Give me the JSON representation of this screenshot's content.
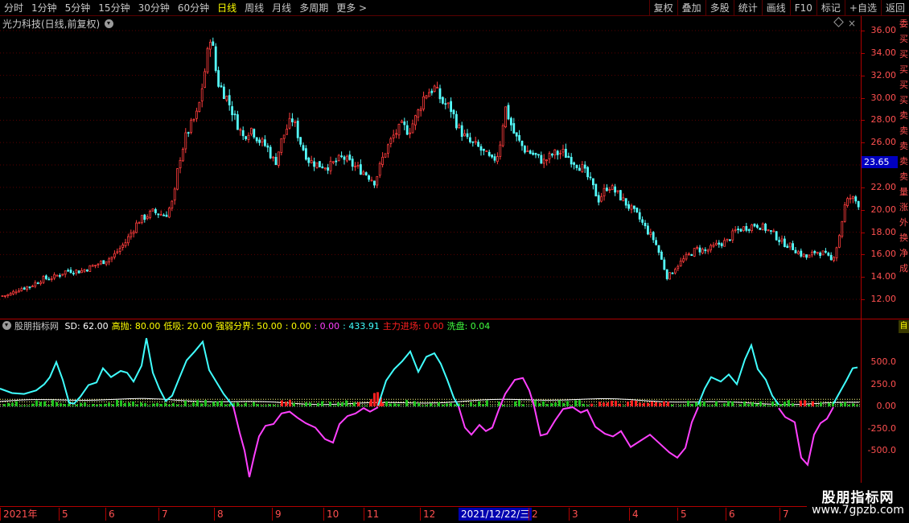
{
  "toolbar": {
    "periods": [
      "分时",
      "1分钟",
      "5分钟",
      "15分钟",
      "30分钟",
      "60分钟",
      "日线",
      "周线",
      "月线",
      "多周期",
      "更多 >"
    ],
    "active_period": "日线",
    "buttons": [
      "复权",
      "叠加",
      "多股",
      "统计",
      "画线",
      "F10",
      "标记",
      "+自选",
      "返回"
    ]
  },
  "stock": {
    "title": "光力科技(日线,前复权)",
    "current_price": "23.65"
  },
  "price_axis": {
    "ticks": [
      "36.00",
      "34.00",
      "32.00",
      "30.00",
      "28.00",
      "26.00",
      "24.00",
      "22.00",
      "20.00",
      "18.00",
      "16.00",
      "14.00",
      "12.00"
    ]
  },
  "side_strip": {
    "chars": [
      "委",
      "买",
      "买",
      "买",
      "买",
      "买",
      "卖",
      "卖",
      "卖",
      "卖",
      "卖",
      "量",
      "涨",
      "外",
      "换",
      "净",
      "成"
    ],
    "tag": "自"
  },
  "indicator": {
    "name": "股朋指标网",
    "legend": [
      {
        "text": "SD: 62.00",
        "color": "#ffffff"
      },
      {
        "text": "高抛: 80.00",
        "color": "#ffff00"
      },
      {
        "text": "低吸: 20.00",
        "color": "#ffff00"
      },
      {
        "text": "强弱分界: 50.00",
        "color": "#ffff00"
      },
      {
        "text": ": 0.00",
        "color": "#ffff00"
      },
      {
        "text": ": 0.00",
        "color": "#ff40ff"
      },
      {
        "text": ": 433.91",
        "color": "#40ffff"
      },
      {
        "text": "主力进场: 0.00",
        "color": "#ff2020"
      },
      {
        "text": "洗盘: 0.04",
        "color": "#40ff40"
      }
    ],
    "axis_ticks": [
      "500.0",
      "250.0",
      "0.00",
      "-250.0",
      "-500.0"
    ]
  },
  "date_axis": {
    "labels": [
      "2021年",
      "5",
      "6",
      "7",
      "8",
      "9",
      "10",
      "11",
      "12",
      "2",
      "3",
      "4",
      "5",
      "6",
      "7"
    ],
    "cursor_date": "2021/12/22/三"
  },
  "watermark": {
    "title": "股朋指标网",
    "url": "www.7gpzb.com"
  },
  "chart_data": [
    {
      "type": "candlestick",
      "title": "光力科技(日线,前复权)",
      "y_range": [
        11,
        37
      ],
      "y_ticks": [
        12,
        14,
        16,
        18,
        20,
        22,
        24,
        26,
        28,
        30,
        32,
        34,
        36
      ],
      "current_price": 23.65,
      "grid": true,
      "close_path": [
        [
          0,
          12.3
        ],
        [
          12,
          12.4
        ],
        [
          22,
          12.9
        ],
        [
          38,
          13.2
        ],
        [
          52,
          13.8
        ],
        [
          68,
          14.0
        ],
        [
          84,
          14.6
        ],
        [
          100,
          14.5
        ],
        [
          120,
          15.1
        ],
        [
          140,
          15.8
        ],
        [
          156,
          17.1
        ],
        [
          172,
          19.0
        ],
        [
          190,
          19.8
        ],
        [
          206,
          19.5
        ],
        [
          216,
          20.9
        ],
        [
          222,
          24.2
        ],
        [
          232,
          26.8
        ],
        [
          246,
          28.7
        ],
        [
          256,
          33.0
        ],
        [
          262,
          35.8
        ],
        [
          270,
          31.5
        ],
        [
          282,
          30.0
        ],
        [
          292,
          28.2
        ],
        [
          302,
          26.5
        ],
        [
          312,
          27.3
        ],
        [
          322,
          26.2
        ],
        [
          332,
          25.6
        ],
        [
          342,
          24.1
        ],
        [
          350,
          26.2
        ],
        [
          358,
          27.5
        ],
        [
          364,
          28.1
        ],
        [
          374,
          25.9
        ],
        [
          384,
          24.4
        ],
        [
          396,
          24.0
        ],
        [
          410,
          23.9
        ],
        [
          426,
          24.7
        ],
        [
          440,
          23.9
        ],
        [
          454,
          23.3
        ],
        [
          466,
          22.5
        ],
        [
          478,
          25.1
        ],
        [
          490,
          26.7
        ],
        [
          500,
          27.5
        ],
        [
          508,
          27.0
        ],
        [
          518,
          28.4
        ],
        [
          528,
          30.3
        ],
        [
          540,
          30.9
        ],
        [
          550,
          29.6
        ],
        [
          560,
          29.1
        ],
        [
          570,
          27.3
        ],
        [
          582,
          26.1
        ],
        [
          594,
          25.6
        ],
        [
          604,
          24.9
        ],
        [
          612,
          24.3
        ],
        [
          620,
          25.1
        ],
        [
          628,
          29.2
        ],
        [
          640,
          26.6
        ],
        [
          652,
          25.4
        ],
        [
          664,
          24.9
        ],
        [
          676,
          24.3
        ],
        [
          688,
          25.0
        ],
        [
          700,
          25.1
        ],
        [
          712,
          24.4
        ],
        [
          724,
          23.7
        ],
        [
          734,
          22.5
        ],
        [
          744,
          20.9
        ],
        [
          756,
          22.2
        ],
        [
          768,
          21.4
        ],
        [
          780,
          20.4
        ],
        [
          792,
          19.5
        ],
        [
          804,
          18.2
        ],
        [
          814,
          17.2
        ],
        [
          822,
          15.6
        ],
        [
          830,
          13.9
        ],
        [
          840,
          14.9
        ],
        [
          852,
          15.7
        ],
        [
          866,
          16.5
        ],
        [
          878,
          16.3
        ],
        [
          892,
          16.9
        ],
        [
          904,
          17.2
        ],
        [
          914,
          18.1
        ],
        [
          926,
          18.4
        ],
        [
          940,
          18.7
        ],
        [
          952,
          18.3
        ],
        [
          962,
          17.8
        ],
        [
          972,
          17.1
        ],
        [
          984,
          16.7
        ],
        [
          994,
          16.1
        ],
        [
          1004,
          15.7
        ],
        [
          1014,
          16.3
        ],
        [
          1024,
          16.1
        ],
        [
          1034,
          15.4
        ],
        [
          1042,
          17.2
        ],
        [
          1050,
          20.3
        ],
        [
          1056,
          21.1
        ],
        [
          1062,
          20.9
        ],
        [
          1068,
          20.5
        ]
      ]
    },
    {
      "type": "line",
      "title": "股朋指标网",
      "y_range": [
        -900,
        800
      ],
      "y_ticks": [
        500,
        250,
        0,
        -250,
        -500
      ],
      "series": [
        {
          "name": "",
          "color": "#40ffff",
          "values": [
            [
              0,
              200
            ],
            [
              15,
              150
            ],
            [
              30,
              140
            ],
            [
              45,
              180
            ],
            [
              55,
              250
            ],
            [
              62,
              330
            ],
            [
              70,
              500
            ],
            [
              78,
              300
            ],
            [
              86,
              40
            ],
            [
              92,
              30
            ],
            [
              100,
              110
            ],
            [
              110,
              240
            ],
            [
              120,
              270
            ],
            [
              128,
              430
            ],
            [
              138,
              330
            ],
            [
              150,
              400
            ],
            [
              158,
              380
            ],
            [
              166,
              280
            ],
            [
              176,
              460
            ],
            [
              182,
              770
            ],
            [
              190,
              380
            ],
            [
              198,
              200
            ],
            [
              206,
              60
            ],
            [
              214,
              120
            ],
            [
              222,
              300
            ],
            [
              232,
              520
            ],
            [
              242,
              620
            ],
            [
              252,
              730
            ],
            [
              260,
              410
            ],
            [
              268,
              290
            ],
            [
              278,
              140
            ],
            [
              290,
              0
            ]
          ]
        },
        {
          "name": "",
          "color": "#ff40ff",
          "values": [
            [
              290,
              0
            ],
            [
              298,
              -300
            ],
            [
              304,
              -500
            ],
            [
              310,
              -800
            ],
            [
              316,
              -560
            ],
            [
              322,
              -340
            ],
            [
              330,
              -220
            ],
            [
              340,
              -200
            ],
            [
              350,
              -80
            ],
            [
              360,
              -60
            ],
            [
              370,
              -130
            ],
            [
              380,
              -190
            ],
            [
              392,
              -240
            ],
            [
              404,
              -370
            ],
            [
              414,
              -410
            ],
            [
              422,
              -200
            ],
            [
              432,
              -110
            ],
            [
              442,
              -80
            ],
            [
              452,
              -20
            ],
            [
              460,
              -60
            ],
            [
              470,
              -10
            ]
          ]
        },
        {
          "name": "",
          "color": "#40ffff",
          "values": [
            [
              470,
              10
            ],
            [
              480,
              290
            ],
            [
              490,
              420
            ],
            [
              500,
              510
            ],
            [
              510,
              620
            ],
            [
              520,
              390
            ],
            [
              530,
              560
            ],
            [
              540,
              600
            ],
            [
              548,
              480
            ],
            [
              556,
              300
            ],
            [
              564,
              100
            ],
            [
              570,
              0
            ]
          ]
        },
        {
          "name": "",
          "color": "#ff40ff",
          "values": [
            [
              570,
              0
            ],
            [
              578,
              -240
            ],
            [
              586,
              -320
            ],
            [
              596,
              -210
            ],
            [
              604,
              -280
            ],
            [
              612,
              -240
            ],
            [
              620,
              -40
            ],
            [
              628,
              140
            ],
            [
              640,
              300
            ],
            [
              650,
              320
            ],
            [
              658,
              180
            ],
            [
              664,
              0
            ],
            [
              672,
              -330
            ],
            [
              680,
              -310
            ],
            [
              690,
              -160
            ],
            [
              700,
              -30
            ],
            [
              712,
              -10
            ],
            [
              722,
              -70
            ],
            [
              730,
              -40
            ],
            [
              740,
              -230
            ],
            [
              752,
              -310
            ],
            [
              762,
              -340
            ],
            [
              772,
              -280
            ],
            [
              784,
              -460
            ],
            [
              796,
              -390
            ],
            [
              808,
              -320
            ],
            [
              820,
              -420
            ],
            [
              832,
              -520
            ],
            [
              842,
              -580
            ],
            [
              852,
              -470
            ],
            [
              860,
              -180
            ],
            [
              868,
              -10
            ]
          ]
        },
        {
          "name": "",
          "color": "#40ffff",
          "values": [
            [
              868,
              20
            ],
            [
              876,
              200
            ],
            [
              884,
              330
            ],
            [
              896,
              280
            ],
            [
              906,
              360
            ],
            [
              916,
              250
            ],
            [
              926,
              530
            ],
            [
              934,
              690
            ],
            [
              942,
              420
            ],
            [
              952,
              300
            ],
            [
              960,
              120
            ],
            [
              968,
              20
            ]
          ]
        },
        {
          "name": "",
          "color": "#ff40ff",
          "values": [
            [
              968,
              -20
            ],
            [
              976,
              -120
            ],
            [
              988,
              -180
            ],
            [
              996,
              -580
            ],
            [
              1004,
              -660
            ],
            [
              1012,
              -320
            ],
            [
              1020,
              -190
            ],
            [
              1028,
              -140
            ],
            [
              1036,
              -10
            ]
          ]
        },
        {
          "name": "",
          "color": "#40ffff",
          "values": [
            [
              1036,
              30
            ],
            [
              1044,
              160
            ],
            [
              1052,
              290
            ],
            [
              1060,
              430
            ],
            [
              1066,
              440
            ]
          ]
        }
      ]
    }
  ]
}
